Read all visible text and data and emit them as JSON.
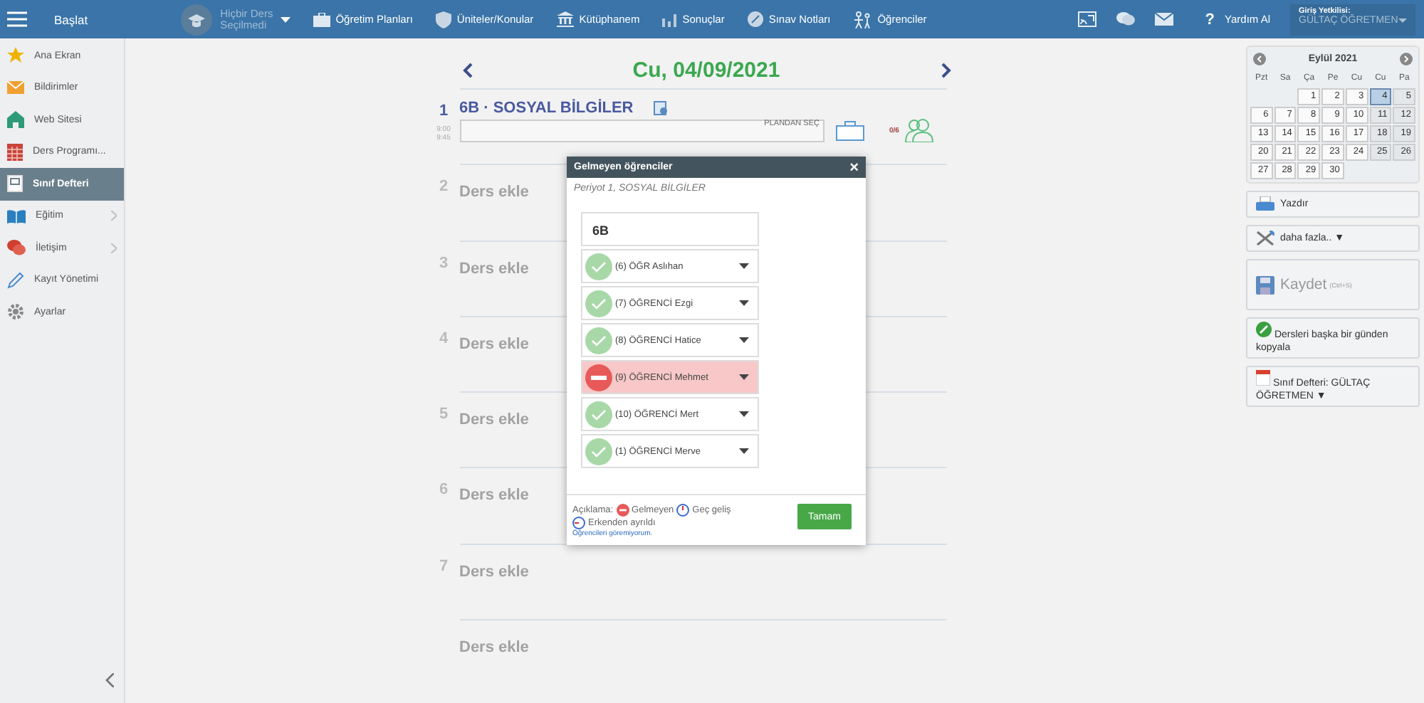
{
  "topbar": {
    "start": "Başlat",
    "course_line1": "Hiçbir Ders",
    "course_line2": "Seçilmedi",
    "nav": [
      {
        "kind": "plans",
        "label": "Öğretim Planları"
      },
      {
        "kind": "units",
        "label": "Üniteler/Konular"
      },
      {
        "kind": "library",
        "label": "Kütüphanem"
      },
      {
        "kind": "results",
        "label": "Sonuçlar"
      },
      {
        "kind": "grades",
        "label": "Sınav Notları"
      },
      {
        "kind": "students",
        "label": "Öğrenciler"
      }
    ],
    "help": "Yardım Al",
    "help_mark": "?",
    "login_label": "Giriş Yetkilisi:",
    "login_user": "GÜLTAÇ ÖĞRETMEN"
  },
  "sidebar": {
    "items": [
      {
        "kind": "star",
        "label": "Ana Ekran",
        "selected": false,
        "submenu": false
      },
      {
        "kind": "mail",
        "label": "Bildirimler",
        "selected": false,
        "submenu": false
      },
      {
        "kind": "home",
        "label": "Web Sitesi",
        "selected": false,
        "submenu": false
      },
      {
        "kind": "grid",
        "label": "Ders Programı...",
        "selected": false,
        "submenu": false
      },
      {
        "kind": "notebook",
        "label": "Sınıf Defteri",
        "selected": true,
        "submenu": false
      },
      {
        "kind": "book",
        "label": "Eğitim",
        "selected": false,
        "submenu": true
      },
      {
        "kind": "chat",
        "label": "İletişim",
        "selected": false,
        "submenu": true
      },
      {
        "kind": "pen",
        "label": "Kayıt Yönetimi",
        "selected": false,
        "submenu": false
      },
      {
        "kind": "gear",
        "label": "Ayarlar",
        "selected": false,
        "submenu": false
      }
    ]
  },
  "day": {
    "date": "Cu, 04/09/2021",
    "periods": [
      {
        "kind": "lesson",
        "number": "1",
        "title": "6B · SOSYAL BİLGİLER",
        "start": "9:00",
        "end": "9:45",
        "plan_button": "PLANDAN SEÇ",
        "attendance": "0/6"
      },
      {
        "kind": "empty",
        "number": "2",
        "label": "Ders ekle"
      },
      {
        "kind": "empty",
        "number": "3",
        "label": "Ders ekle"
      },
      {
        "kind": "empty",
        "number": "4",
        "label": "Ders ekle"
      },
      {
        "kind": "empty",
        "number": "5",
        "label": "Ders ekle"
      },
      {
        "kind": "empty",
        "number": "6",
        "label": "Ders ekle"
      },
      {
        "kind": "empty",
        "number": "7",
        "label": "Ders ekle"
      },
      {
        "kind": "empty",
        "label": "Ders ekle"
      }
    ]
  },
  "dialog": {
    "title": "Gelmeyen öğrenciler",
    "close": "×",
    "subtitle": "Periyot 1, SOSYAL BİLGİLER",
    "class_name": "6B",
    "students": [
      {
        "name": "(6) ÖĞR Aslıhan",
        "absent": false
      },
      {
        "name": "(7) ÖĞRENCİ Ezgi",
        "absent": false
      },
      {
        "name": "(8) ÖĞRENCİ Hatice",
        "absent": false
      },
      {
        "name": "(9) ÖĞRENCİ Mehmet",
        "absent": true
      },
      {
        "name": "(10) ÖĞRENCİ Mert",
        "absent": false
      },
      {
        "name": "(1) ÖĞRENCİ Merve",
        "absent": false
      }
    ],
    "legend_label": "Açıklama:",
    "legend_absent": "Gelmeyen",
    "legend_late": "Geç geliş",
    "legend_early": "Erkenden ayrıldı",
    "link": "Öğrencileri göremiyorum.",
    "ok": "Tamam"
  },
  "calendar": {
    "title": "Eylül 2021",
    "weekdays": [
      "Pzt",
      "Sa",
      "Ça",
      "Pe",
      "Cu",
      "Cu",
      "Pa"
    ],
    "weeks": [
      [
        {
          "kind": "empty"
        },
        {
          "kind": "empty"
        },
        {
          "kind": "day",
          "day": "1",
          "selected": false,
          "weekend": false
        },
        {
          "kind": "day",
          "day": "2",
          "selected": false,
          "weekend": false
        },
        {
          "kind": "day",
          "day": "3",
          "selected": false,
          "weekend": false
        },
        {
          "kind": "day",
          "day": "4",
          "selected": true,
          "weekend": true
        },
        {
          "kind": "day",
          "day": "5",
          "selected": false,
          "weekend": true
        }
      ],
      [
        {
          "kind": "day",
          "day": "6",
          "selected": false,
          "weekend": false
        },
        {
          "kind": "day",
          "day": "7",
          "selected": false,
          "weekend": false
        },
        {
          "kind": "day",
          "day": "8",
          "selected": false,
          "weekend": false
        },
        {
          "kind": "day",
          "day": "9",
          "selected": false,
          "weekend": false
        },
        {
          "kind": "day",
          "day": "10",
          "selected": false,
          "weekend": false
        },
        {
          "kind": "day",
          "day": "11",
          "selected": false,
          "weekend": true
        },
        {
          "kind": "day",
          "day": "12",
          "selected": false,
          "weekend": true
        }
      ],
      [
        {
          "kind": "day",
          "day": "13",
          "selected": false,
          "weekend": false
        },
        {
          "kind": "day",
          "day": "14",
          "selected": false,
          "weekend": false
        },
        {
          "kind": "day",
          "day": "15",
          "selected": false,
          "weekend": false
        },
        {
          "kind": "day",
          "day": "16",
          "selected": false,
          "weekend": false
        },
        {
          "kind": "day",
          "day": "17",
          "selected": false,
          "weekend": false
        },
        {
          "kind": "day",
          "day": "18",
          "selected": false,
          "weekend": true
        },
        {
          "kind": "day",
          "day": "19",
          "selected": false,
          "weekend": true
        }
      ],
      [
        {
          "kind": "day",
          "day": "20",
          "selected": false,
          "weekend": false
        },
        {
          "kind": "day",
          "day": "21",
          "selected": false,
          "weekend": false
        },
        {
          "kind": "day",
          "day": "22",
          "selected": false,
          "weekend": false
        },
        {
          "kind": "day",
          "day": "23",
          "selected": false,
          "weekend": false
        },
        {
          "kind": "day",
          "day": "24",
          "selected": false,
          "weekend": false
        },
        {
          "kind": "day",
          "day": "25",
          "selected": false,
          "weekend": true
        },
        {
          "kind": "day",
          "day": "26",
          "selected": false,
          "weekend": true
        }
      ],
      [
        {
          "kind": "day",
          "day": "27",
          "selected": false,
          "weekend": false
        },
        {
          "kind": "day",
          "day": "28",
          "selected": false,
          "weekend": false
        },
        {
          "kind": "day",
          "day": "29",
          "selected": false,
          "weekend": false
        },
        {
          "kind": "day",
          "day": "30",
          "selected": false,
          "weekend": false
        },
        {
          "kind": "empty"
        },
        {
          "kind": "empty"
        },
        {
          "kind": "empty"
        }
      ]
    ]
  },
  "actions": {
    "print": "Yazdır",
    "more": "daha fazla..",
    "more_caret": "▼",
    "save": "Kaydet",
    "save_hint": "(Ctrl+S)",
    "copy": "Dersleri başka bir günden kopyala",
    "notebook": "Sınıf Defteri: GÜLTAÇ ÖĞRETMEN",
    "notebook_caret": "▼"
  }
}
